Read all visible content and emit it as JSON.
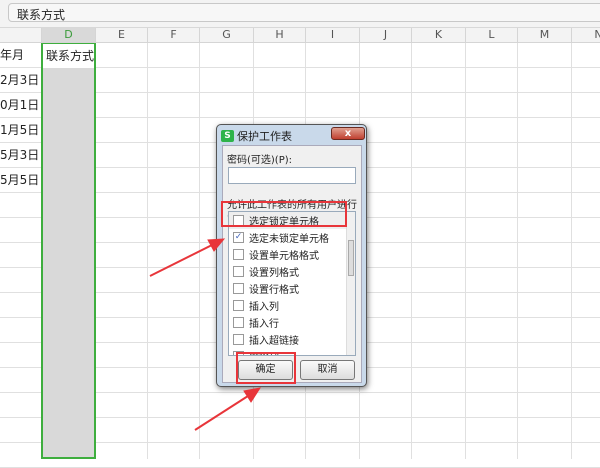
{
  "formula_bar": {
    "value": "联系方式"
  },
  "columns": [
    "D",
    "E",
    "F",
    "G",
    "H",
    "I",
    "J",
    "K",
    "L",
    "M",
    "N"
  ],
  "cells_c": [
    "年月",
    "2月3日",
    "0月1日",
    "1月5日",
    "5月3日",
    "5月5日"
  ],
  "cell_d1": "联系方式",
  "dialog": {
    "title": "保护工作表",
    "close": "x",
    "password_label": "密码(可选)(P):",
    "password_value": "",
    "allow_label": "允许此工作表的所有用户进行(A):",
    "options": [
      {
        "label": "选定锁定单元格",
        "checked": false
      },
      {
        "label": "选定未锁定单元格",
        "checked": true
      },
      {
        "label": "设置单元格格式",
        "checked": false
      },
      {
        "label": "设置列格式",
        "checked": false
      },
      {
        "label": "设置行格式",
        "checked": false
      },
      {
        "label": "插入列",
        "checked": false
      },
      {
        "label": "插入行",
        "checked": false
      },
      {
        "label": "插入超链接",
        "checked": false
      },
      {
        "label": "删除列",
        "checked": false
      }
    ],
    "ok": "确定",
    "cancel": "取消"
  },
  "annotation_color": "#e8353a"
}
